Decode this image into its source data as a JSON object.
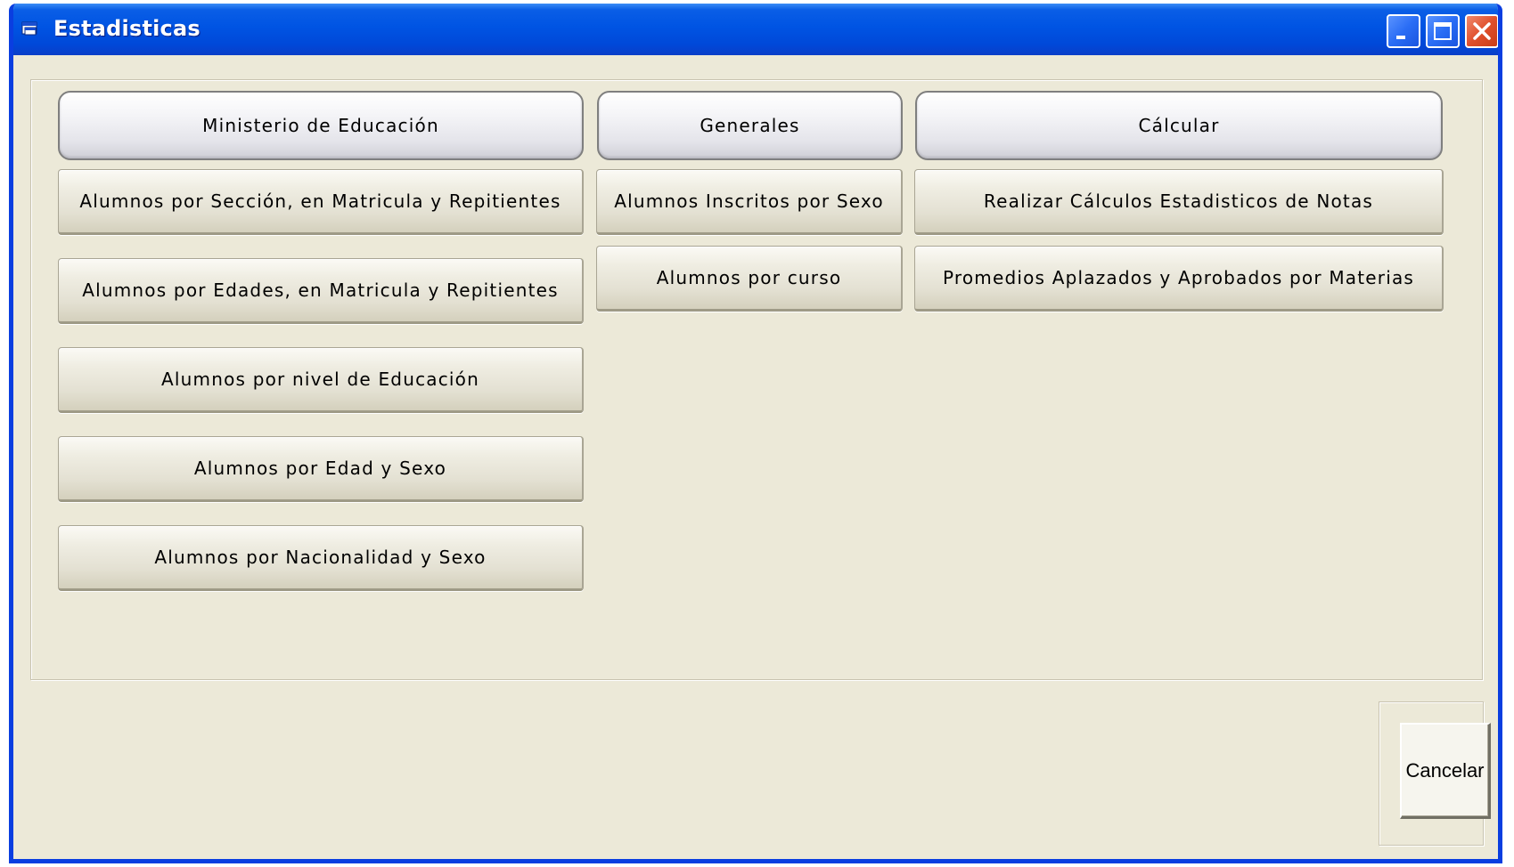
{
  "window": {
    "title": "Estadisticas",
    "title_color": "#ffffff",
    "titlebar_color": "#0054e3",
    "background_color": "#ece9d8"
  },
  "title_controls": {
    "minimize_icon": "minimize-icon",
    "maximize_icon": "maximize-icon",
    "close_icon": "close-icon"
  },
  "headers": {
    "ministerio": "Ministerio de Educación",
    "generales": "Generales",
    "calcular": "Cálcular"
  },
  "ministerio_buttons": [
    "Alumnos por Sección, en Matricula y Repitientes",
    "Alumnos por Edades, en Matricula y Repitientes",
    "Alumnos por nivel de Educación",
    "Alumnos por Edad y Sexo",
    "Alumnos por Nacionalidad y Sexo"
  ],
  "generales_buttons": [
    "Alumnos Inscritos por Sexo",
    "Alumnos por curso"
  ],
  "calcular_buttons": [
    "Realizar Cálculos Estadisticos de Notas",
    "Promedios Aplazados y Aprobados por Materias"
  ],
  "footer": {
    "cancel_label": "Cancelar"
  }
}
